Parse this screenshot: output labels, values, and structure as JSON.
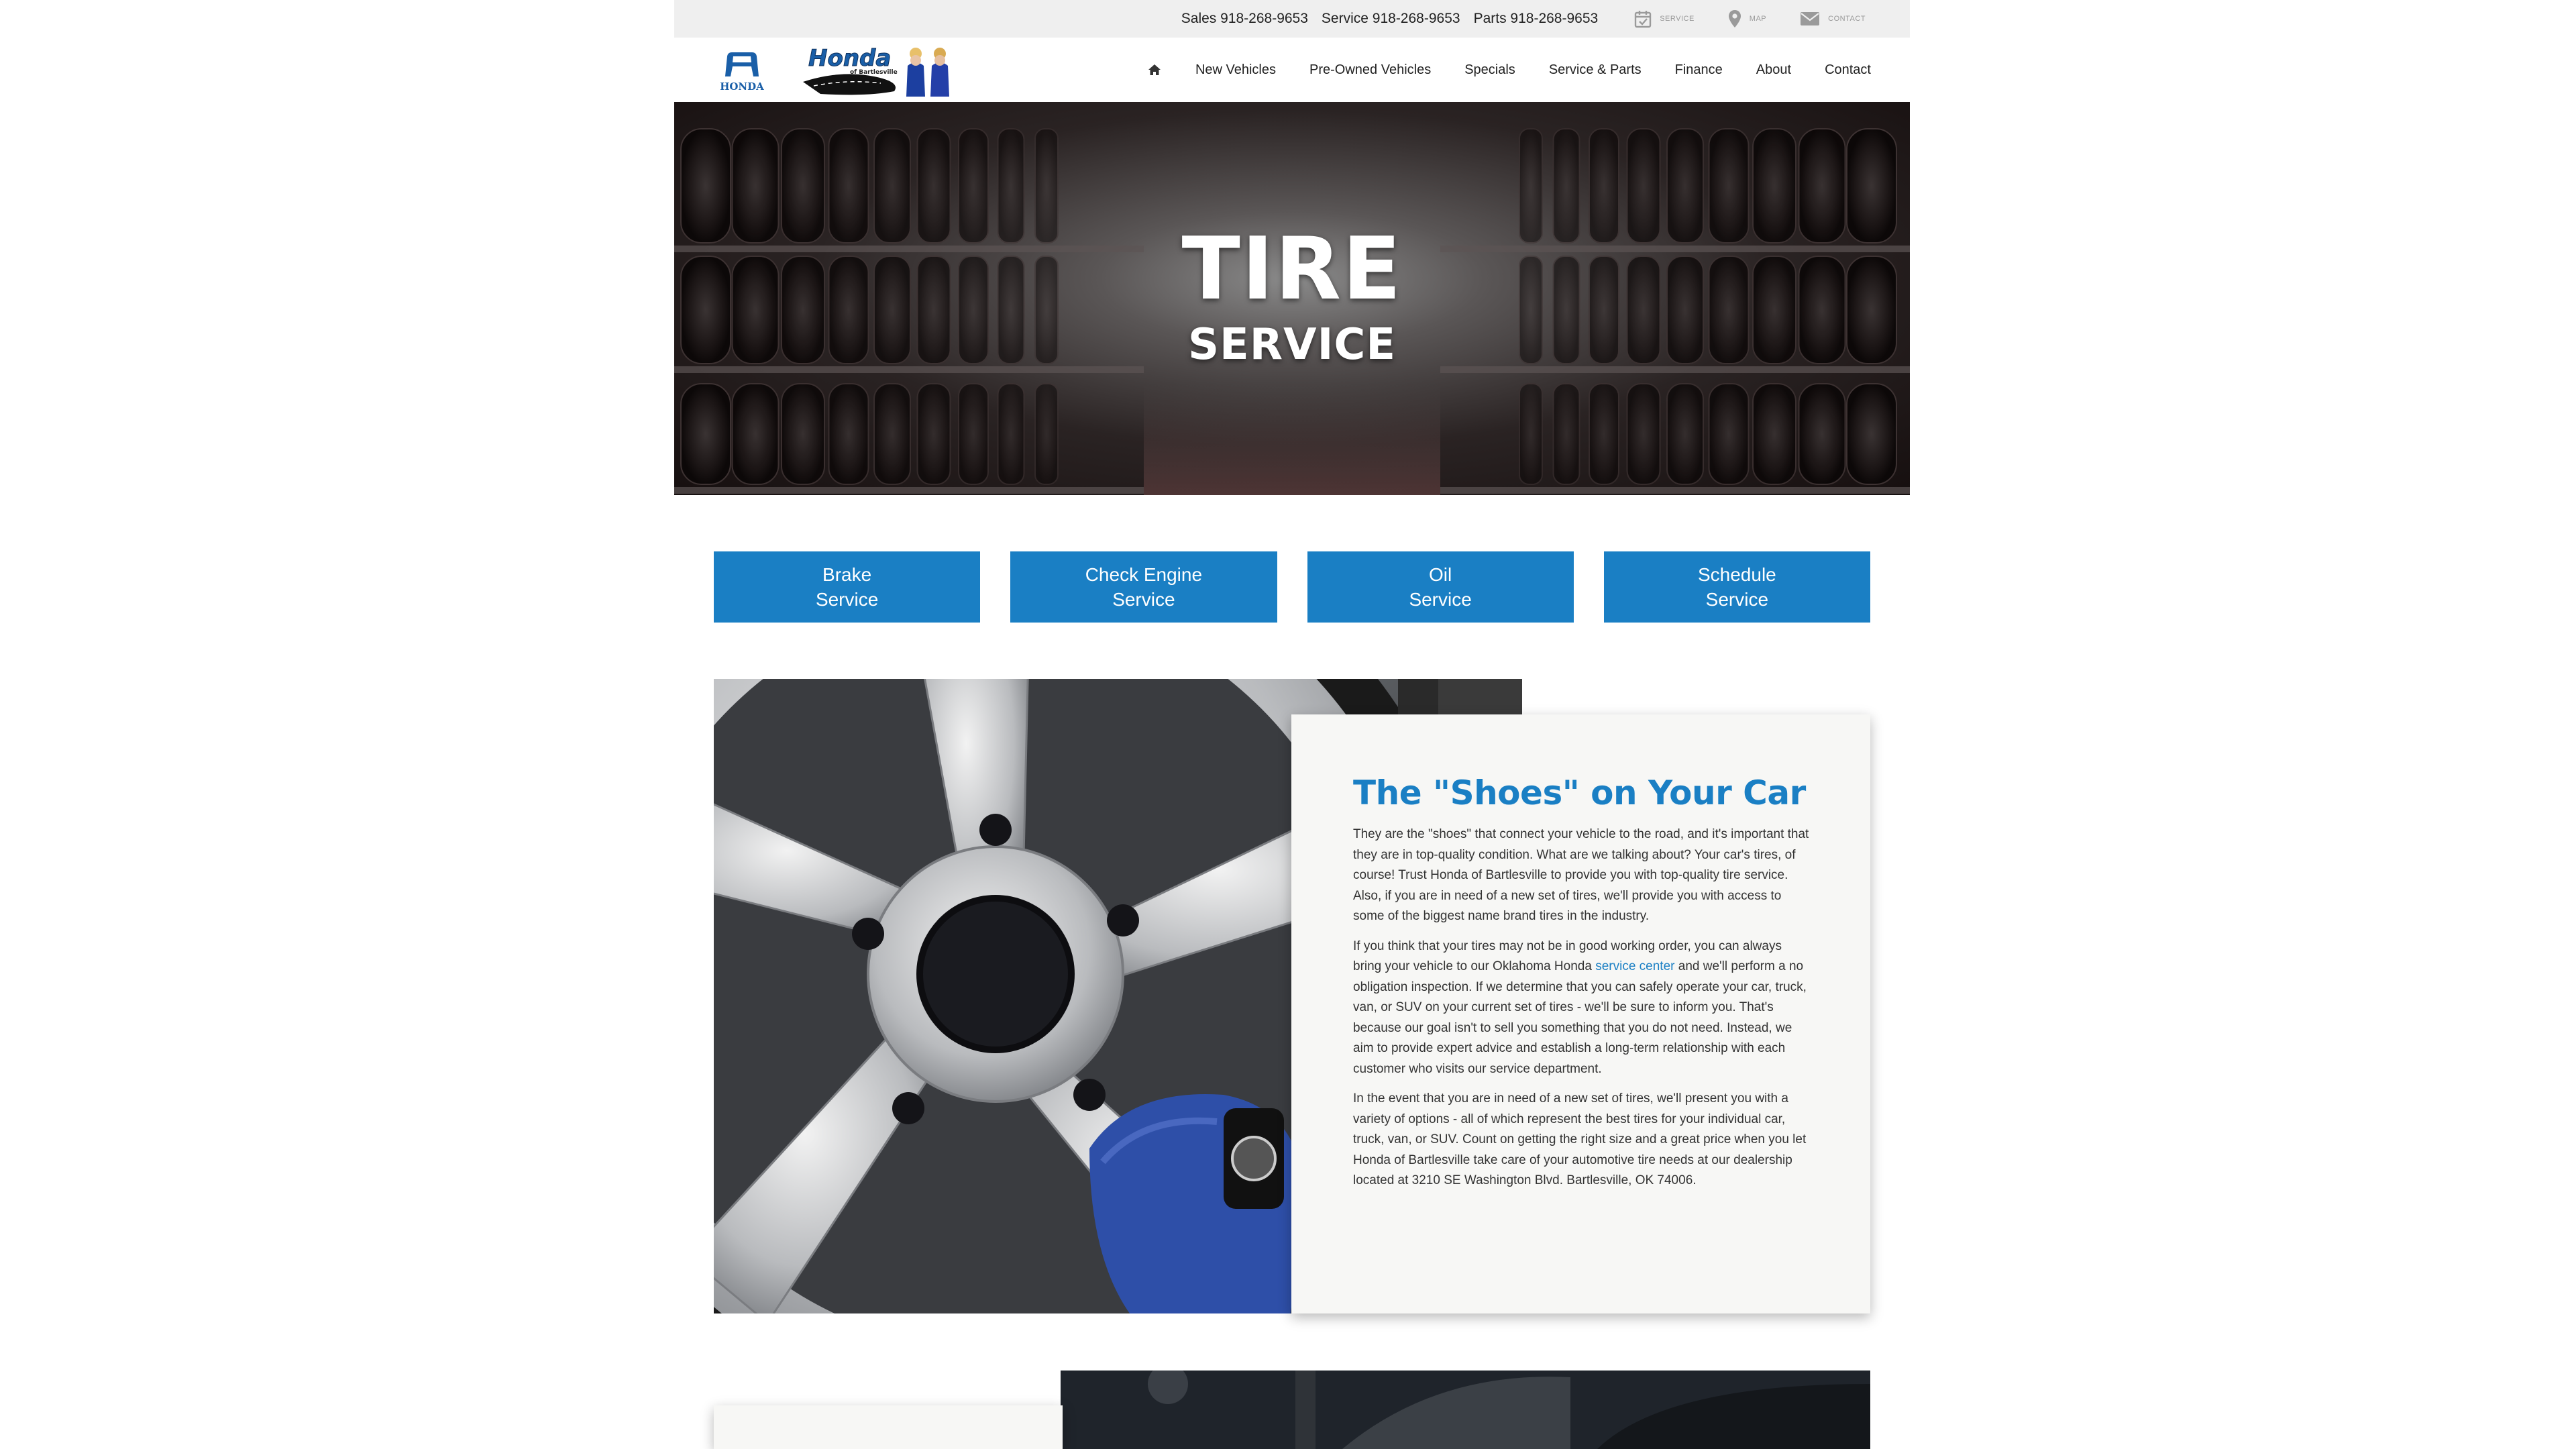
{
  "topbar": {
    "phones": [
      {
        "label": "Sales 918-268-9653"
      },
      {
        "label": "Service 918-268-9653"
      },
      {
        "label": "Parts 918-268-9653"
      }
    ],
    "quick_links": [
      {
        "label": "SERVICE",
        "icon": "calendar-check-icon"
      },
      {
        "label": "MAP",
        "icon": "map-pin-icon"
      },
      {
        "label": "CONTACT",
        "icon": "envelope-icon"
      }
    ]
  },
  "header": {
    "brand_logo_text": "HONDA",
    "dealer_logo_text": "Honda",
    "dealer_logo_subtext": "of Bartlesville"
  },
  "nav": {
    "items": [
      {
        "label": "New Vehicles"
      },
      {
        "label": "Pre-Owned Vehicles"
      },
      {
        "label": "Specials"
      },
      {
        "label": "Service & Parts"
      },
      {
        "label": "Finance"
      },
      {
        "label": "About"
      },
      {
        "label": "Contact"
      }
    ]
  },
  "hero": {
    "title_line1": "TIRE",
    "title_line2": "SERVICE"
  },
  "service_buttons": [
    {
      "label": "Brake\nService"
    },
    {
      "label": "Check Engine\nService"
    },
    {
      "label": "Oil\nService"
    },
    {
      "label": "Schedule\nService"
    }
  ],
  "content": {
    "heading": "The \"Shoes\" on Your Car",
    "p1": "They are the \"shoes\" that connect your vehicle to the road, and it's important that they are in top-quality condition. What are we talking about? Your car's tires, of course! Trust Honda of Bartlesville to provide you with top-quality tire service. Also, if you are in need of a new set of tires, we'll provide you with access to some of the biggest name brand tires in the industry.",
    "p2_before": "If you think that your tires may not be in good working order, you can always bring your vehicle to our Oklahoma Honda ",
    "p2_link": "service center",
    "p2_after": " and we'll perform a no obligation inspection. If we determine that you can safely operate your car, truck, van, or SUV on your current set of tires - we'll be sure to inform you. That's because our goal isn't to sell you something that you do not need. Instead, we aim to provide expert advice and establish a long-term relationship with each customer who visits our service department.",
    "p3": "In the event that you are in need of a new set of tires, we'll present you with a variety of options - all of which represent the best tires for your individual car, truck, van, or SUV. Count on getting the right size and a great price when you let Honda of Bartlesville take care of your automotive tire needs at our dealership located at 3210 SE Washington Blvd. Bartlesville, OK 74006."
  },
  "colors": {
    "accent": "#1a7fc4",
    "topbar_bg": "#efefef",
    "card_bg": "#f7f7f5"
  }
}
